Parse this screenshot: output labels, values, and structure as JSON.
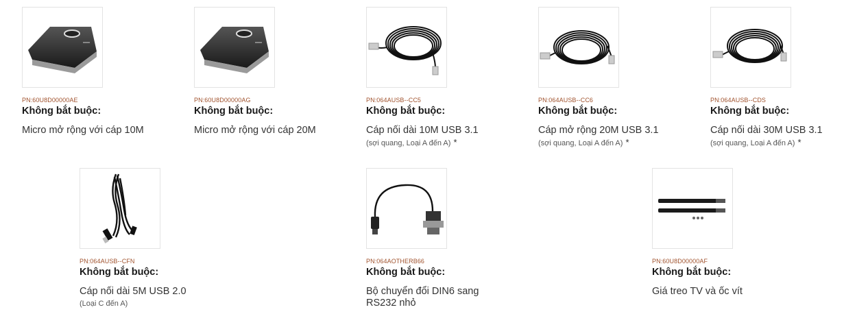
{
  "products": [
    {
      "pn": "PN:60U8D00000AE",
      "required": "Không bắt buộc:",
      "desc": "Micro mở rộng với cáp 10M",
      "note": "",
      "star": "",
      "image": "microphone-pod"
    },
    {
      "pn": "PN:60U8D00000AG",
      "required": "Không bắt buộc:",
      "desc": "Micro mở rộng với cáp 20M",
      "note": "",
      "star": "",
      "image": "microphone-pod"
    },
    {
      "pn": "PN:064AUSB--CC5",
      "required": "Không bắt buộc:",
      "desc": "Cáp nối dài 10M USB 3.1",
      "note": "(sợi quang, Loại A đến A)",
      "star": "*",
      "image": "cable-coil"
    },
    {
      "pn": "PN:064AUSB--CC6",
      "required": "Không bắt buộc:",
      "desc": "Cáp mở rộng 20M USB 3.1",
      "note": "(sợi quang, Loại A đến A)",
      "star": "*",
      "image": "cable-coil"
    },
    {
      "pn": "PN:064AUSB--CDS",
      "required": "Không bắt buộc:",
      "desc": "Cáp nối dài 30M USB 3.1",
      "note": "(sợi quang, Loại A đến A)",
      "star": "*",
      "image": "cable-coil"
    },
    {
      "pn": "PN:064AUSB--CFN",
      "required": "Không bắt buộc:",
      "desc": "Cáp nối dài 5M USB 2.0",
      "note": "(Loại C đến A)",
      "star": "",
      "image": "usb-cable-bundle"
    },
    {
      "pn": "PN:064AOTHERB66",
      "required": "Không bắt buộc:",
      "desc": "Bộ chuyển đổi DIN6 sang RS232 nhỏ",
      "note": "",
      "star": "",
      "image": "din6-rs232-adapter"
    },
    {
      "pn": "PN:60U8D00000AF",
      "required": "Không bắt buộc:",
      "desc": "Giá treo TV và ốc vít",
      "note": "",
      "star": "",
      "image": "tv-mount-bars"
    }
  ]
}
